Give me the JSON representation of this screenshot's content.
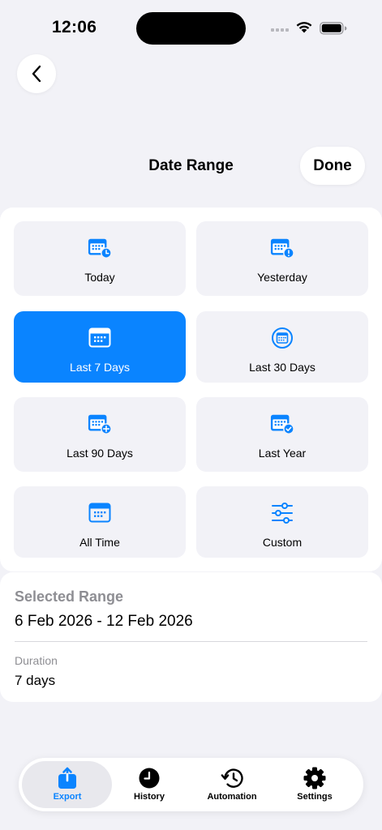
{
  "status": {
    "time": "12:06"
  },
  "nav": {
    "title": "Date Range",
    "done_label": "Done"
  },
  "options": [
    {
      "label": "Today",
      "icon": "calendar-clock-icon",
      "selected": false
    },
    {
      "label": "Yesterday",
      "icon": "calendar-exclamation-icon",
      "selected": false
    },
    {
      "label": "Last 7 Days",
      "icon": "calendar-icon",
      "selected": true
    },
    {
      "label": "Last 30 Days",
      "icon": "calendar-circle-icon",
      "selected": false
    },
    {
      "label": "Last 90 Days",
      "icon": "calendar-plus-icon",
      "selected": false
    },
    {
      "label": "Last Year",
      "icon": "calendar-check-icon",
      "selected": false
    },
    {
      "label": "All Time",
      "icon": "calendar-icon",
      "selected": false
    },
    {
      "label": "Custom",
      "icon": "sliders-icon",
      "selected": false
    }
  ],
  "range": {
    "title": "Selected Range",
    "value": "6 Feb 2026 - 12 Feb 2026",
    "duration_title": "Duration",
    "duration_value": "7 days"
  },
  "tabs": [
    {
      "label": "Export",
      "icon": "export-icon",
      "active": true
    },
    {
      "label": "History",
      "icon": "clock-icon",
      "active": false
    },
    {
      "label": "Automation",
      "icon": "history-icon",
      "active": false
    },
    {
      "label": "Settings",
      "icon": "gear-icon",
      "active": false
    }
  ],
  "colors": {
    "accent": "#0A84FF",
    "background": "#F2F2F7",
    "card": "#FFFFFF"
  }
}
